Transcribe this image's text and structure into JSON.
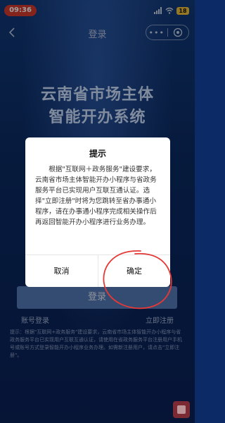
{
  "status_bar": {
    "time": "09:36",
    "battery": "18"
  },
  "nav": {
    "title": "登录"
  },
  "hero": {
    "line1": "云南省市场主体",
    "line2": "智能开办系统"
  },
  "form": {
    "login_label": "登录",
    "account_login": "账号登录",
    "register": "立即注册"
  },
  "footnote": "提示：根据\"互联网+政务服务\"建设要求，云南省市场主体智能开办小程序与省政务服务平台已实现用户互联互通认证，请使用在省政务服务平台注册用户手机号或账号方式登录智能开办小程序业务办理。如需新注册用户，请点击\"立即注册\"。",
  "dialog": {
    "title": "提示",
    "body": "根据\"互联网＋政务服务\"建设要求，云南省市场主体智能开办小程序与省政务服务平台已实现用户互联互通认证。选择\"立即注册\"时将为您跳转至省办事通小程序，请在办事通小程序完成相关操作后再返回智能开办小程序进行业务办理。",
    "cancel": "取消",
    "confirm": "确定"
  },
  "colors": {
    "annotation": "#e53935",
    "accent": "#5479b8",
    "status_time_bg": "#d63b2f"
  }
}
